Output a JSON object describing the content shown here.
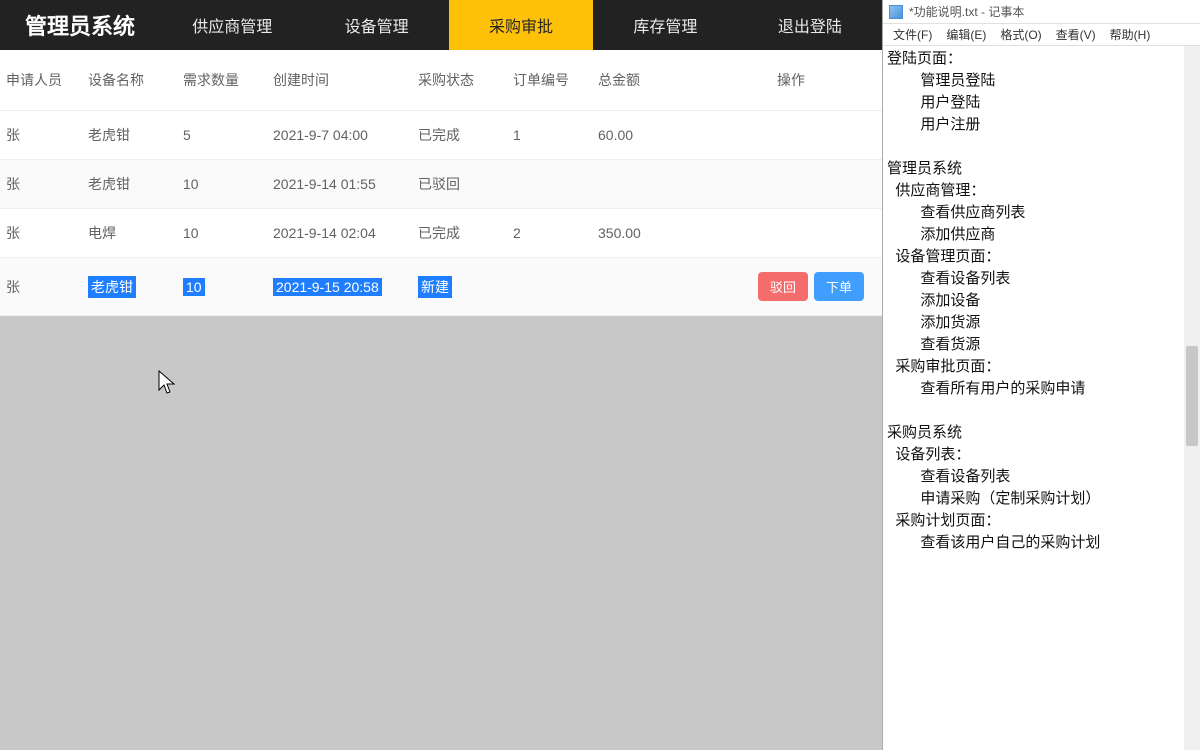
{
  "brand": "管理员系统",
  "nav": [
    {
      "label": "供应商管理",
      "active": false
    },
    {
      "label": "设备管理",
      "active": false
    },
    {
      "label": "采购审批",
      "active": true
    },
    {
      "label": "库存管理",
      "active": false
    },
    {
      "label": "退出登陆",
      "active": false
    }
  ],
  "columns": {
    "applicant": "申请人员",
    "device": "设备名称",
    "qty": "需求数量",
    "time": "创建时间",
    "status": "采购状态",
    "order": "订单编号",
    "amount": "总金额",
    "op": "操作"
  },
  "rows": [
    {
      "applicant": "张",
      "device": "老虎钳",
      "qty": "5",
      "time": "2021-9-7 04:00",
      "status": "已完成",
      "order": "1",
      "amount": "60.00",
      "highlight": false,
      "actions": false
    },
    {
      "applicant": "张",
      "device": "老虎钳",
      "qty": "10",
      "time": "2021-9-14 01:55",
      "status": "已驳回",
      "order": "",
      "amount": "",
      "highlight": false,
      "actions": false
    },
    {
      "applicant": "张",
      "device": "电焊",
      "qty": "10",
      "time": "2021-9-14 02:04",
      "status": "已完成",
      "order": "2",
      "amount": "350.00",
      "highlight": false,
      "actions": false
    },
    {
      "applicant": "张",
      "device": "老虎钳",
      "qty": "10",
      "time": "2021-9-15 20:58",
      "status": "新建",
      "order": "",
      "amount": "",
      "highlight": true,
      "actions": true
    }
  ],
  "buttons": {
    "reject": "驳回",
    "order": "下单"
  },
  "notepad": {
    "title": "*功能说明.txt - 记事本",
    "menu": {
      "file": "文件(F)",
      "edit": "编辑(E)",
      "format": "格式(O)",
      "view": "查看(V)",
      "help": "帮助(H)"
    },
    "content": "登陆页面：\n        管理员登陆\n        用户登陆\n        用户注册\n\n管理员系统\n  供应商管理：\n        查看供应商列表\n        添加供应商\n  设备管理页面：\n        查看设备列表\n        添加设备\n        添加货源\n        查看货源\n  采购审批页面：\n        查看所有用户的采购申请\n\n采购员系统\n  设备列表：\n        查看设备列表\n        申请采购（定制采购计划）\n  采购计划页面：\n        查看该用户自己的采购计划"
  }
}
